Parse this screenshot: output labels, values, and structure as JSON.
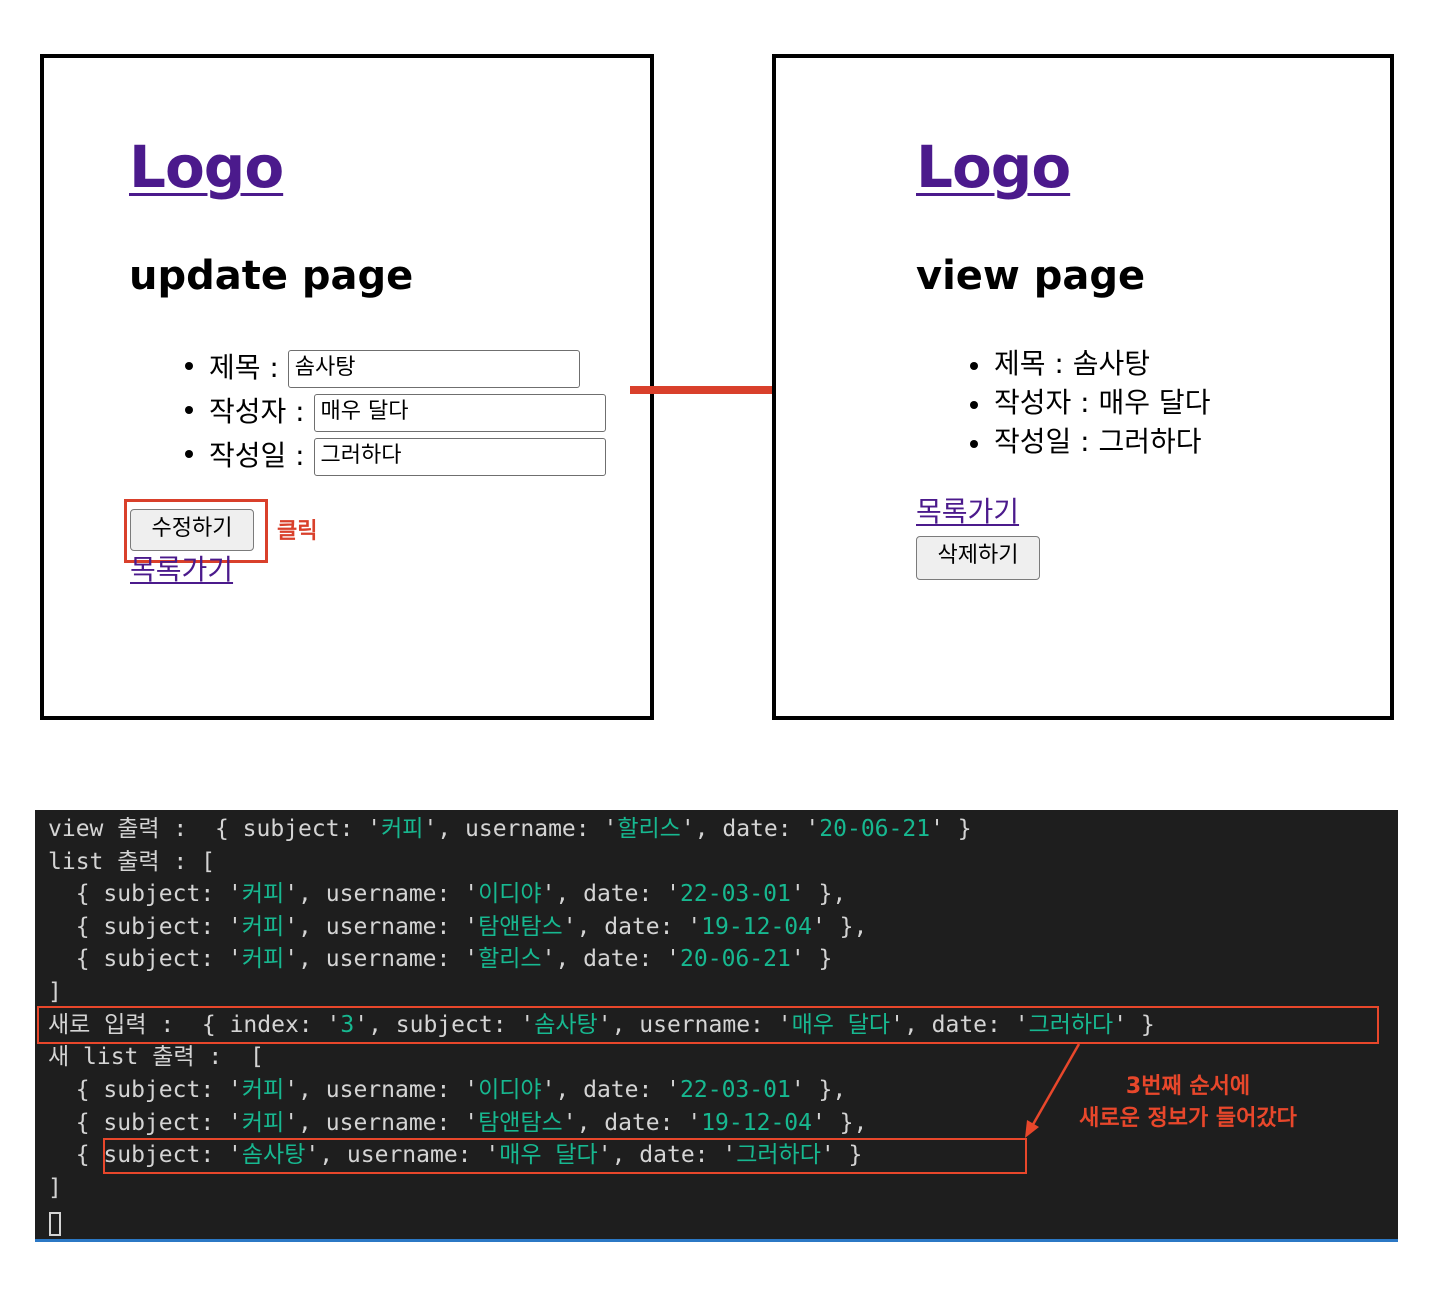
{
  "update_panel": {
    "logo": "Logo",
    "title": "update page",
    "fields": [
      {
        "label": "제목 :",
        "value": "솜사탕"
      },
      {
        "label": "작성자 :",
        "value": "매우 달다"
      },
      {
        "label": "작성일 :",
        "value": "그러하다"
      }
    ],
    "submit_button": "수정하기",
    "click_annotation": "클릭",
    "list_link": "목록가기"
  },
  "view_panel": {
    "logo": "Logo",
    "title": "view page",
    "items": [
      "제목 : 솜사탕",
      "작성자 : 매우 달다",
      "작성일 : 그러하다"
    ],
    "list_link": "목록가기",
    "delete_button": "삭제하기"
  },
  "terminal": {
    "view_label": "view 출력 : ",
    "view_obj": {
      "subject": "커피",
      "username": "할리스",
      "date": "20-06-21"
    },
    "list_label": "list 출력 : [",
    "list_items": [
      {
        "subject": "커피",
        "username": "이디야",
        "date": "22-03-01"
      },
      {
        "subject": "커피",
        "username": "탐앤탐스",
        "date": "19-12-04"
      },
      {
        "subject": "커피",
        "username": "할리스",
        "date": "20-06-21"
      }
    ],
    "new_input_label": "새로 입력 : ",
    "new_input": {
      "index": "3",
      "subject": "솜사탕",
      "username": "매우 달다",
      "date": "그러하다"
    },
    "new_list_label": "새 list 출력 :  [",
    "new_list_items": [
      {
        "subject": "커피",
        "username": "이디야",
        "date": "22-03-01"
      },
      {
        "subject": "커피",
        "username": "탐앤탐스",
        "date": "19-12-04"
      },
      {
        "subject": "솜사탕",
        "username": "매우 달다",
        "date": "그러하다"
      }
    ],
    "close_bracket": "]",
    "note_line1": "3번째 순서에",
    "note_line2": "새로운 정보가 들어갔다"
  },
  "colors": {
    "accent": "#d9402b",
    "link": "#4b1a8c",
    "terminal_bg": "#1e1e1e",
    "string": "#17b890"
  }
}
